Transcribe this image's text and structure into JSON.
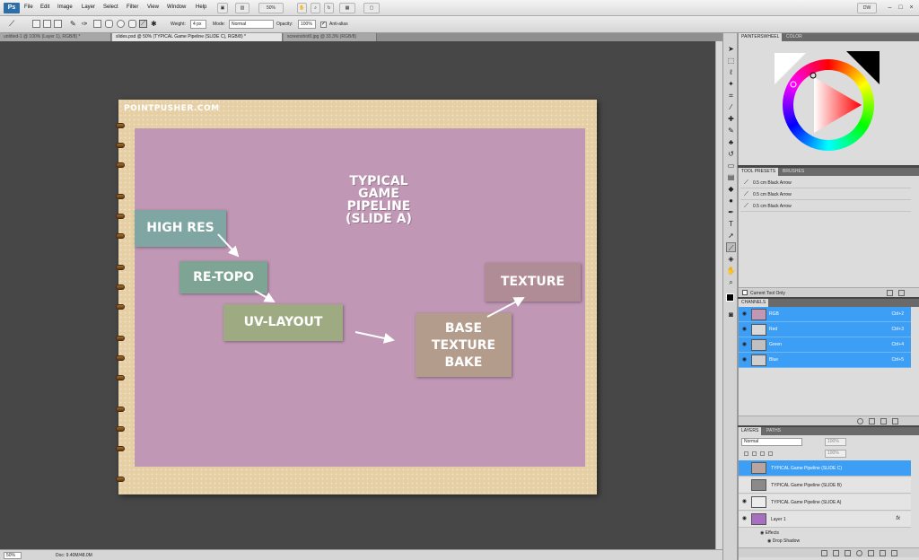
{
  "app": {
    "logo": "Ps",
    "menu": [
      "File",
      "Edit",
      "Image",
      "Layer",
      "Select",
      "Filter",
      "View",
      "Window",
      "Help"
    ],
    "zoom_menu": "50%",
    "workspace": "DW"
  },
  "options": {
    "weight_label": "Weight:",
    "weight_value": "4 px",
    "mode_label": "Mode:",
    "mode_value": "Normal",
    "opacity_label": "Opacity:",
    "opacity_value": "100%",
    "antialias_label": "Anti-alias"
  },
  "tabs": [
    {
      "label": "untitled-1 @ 100% (Layer 1), RGB/8) *",
      "active": false
    },
    {
      "label": "slides.psd @ 50% (TYPICAL Game Pipeline (SLIDE C), RGB/8) *",
      "active": true
    },
    {
      "label": "screenshot0.jpg @ 33.3% (RGB/8)",
      "active": false
    }
  ],
  "slide": {
    "brand": "POINTPUSHER.COM",
    "title": [
      "TYPICAL",
      "GAME",
      "PIPELINE",
      "(SLIDE A)"
    ],
    "cards": {
      "high_res": "HIGH RES",
      "retopo": "RE-TOPO",
      "uv_layout": "UV-LAYOUT",
      "base_bake": [
        "BASE",
        "TEXTURE",
        "BAKE"
      ],
      "texture": "TEXTURE"
    },
    "colors": {
      "background": "#c097b5",
      "high_res": "#7fa6a3",
      "retopo": "#7ea593",
      "uv_layout": "#9eab82",
      "base_bake": "#b39c8c",
      "texture": "#b08c96"
    }
  },
  "status": {
    "zoom": "50%",
    "doc": "Doc: 9.40M/48.0M"
  },
  "color_panel": {
    "tabs": [
      "PAINTERSWHEEL",
      "COLOR"
    ]
  },
  "presets_panel": {
    "tabs": [
      "TOOL PRESETS",
      "BRUSHES"
    ],
    "items": [
      "0.5 cm Black Arrow",
      "0.5 cm Black Arrow",
      "0.5 cm Black Arrow"
    ],
    "current_only": "Current Tool Only"
  },
  "channels_panel": {
    "tab": "CHANNELS",
    "rows": [
      {
        "name": "RGB",
        "key": "Ctrl+2"
      },
      {
        "name": "Red",
        "key": "Ctrl+3"
      },
      {
        "name": "Green",
        "key": "Ctrl+4"
      },
      {
        "name": "Blue",
        "key": "Ctrl+5"
      }
    ]
  },
  "layers_panel": {
    "tabs": [
      "LAYERS",
      "PATHS"
    ],
    "blend_mode": "Normal",
    "opacity": "100%",
    "fill": "100%",
    "rows": [
      {
        "name": "TYPICAL  Game  Pipeline (SLIDE C)",
        "selected": true
      },
      {
        "name": "TYPICAL  Game  Pipeline (SLIDE B)",
        "selected": false
      },
      {
        "name": "TYPICAL  Game  Pipeline (SLIDE A)",
        "selected": false
      },
      {
        "name": "Layer 1",
        "selected": false,
        "fx": "fx"
      }
    ],
    "effects_label": "Effects",
    "drop_shadow_label": "Drop Shadow"
  }
}
